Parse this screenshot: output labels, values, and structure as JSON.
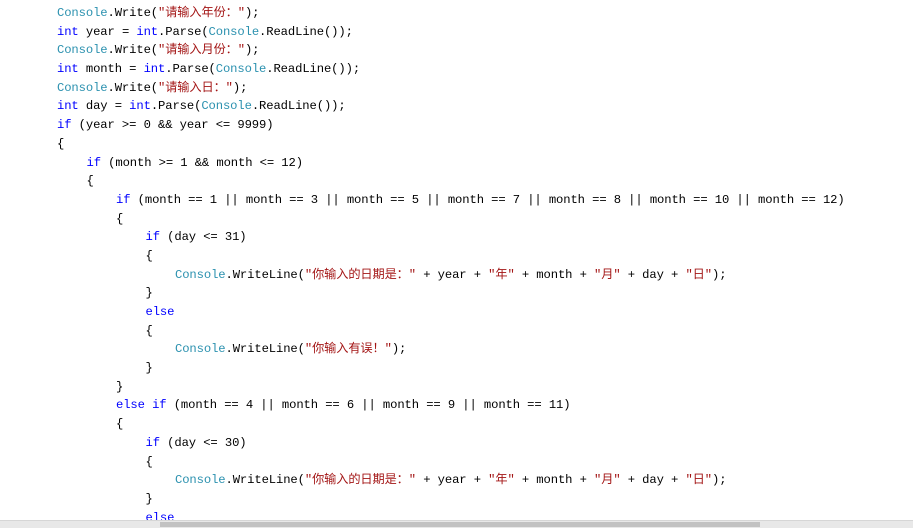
{
  "colors": {
    "keyword": "#0000ff",
    "type": "#2b91af",
    "string": "#a31515",
    "text": "#000000"
  },
  "code_lines": [
    {
      "indent": 0,
      "tokens": [
        [
          "ty",
          "Console"
        ],
        [
          "pl",
          ".Write("
        ],
        [
          "st",
          "\"请输入年份：\""
        ],
        [
          "pl",
          ");"
        ]
      ]
    },
    {
      "indent": 0,
      "tokens": [
        [
          "kw",
          "int"
        ],
        [
          "pl",
          " year = "
        ],
        [
          "kw",
          "int"
        ],
        [
          "pl",
          ".Parse("
        ],
        [
          "ty",
          "Console"
        ],
        [
          "pl",
          ".ReadLine());"
        ]
      ]
    },
    {
      "indent": 0,
      "tokens": [
        [
          "ty",
          "Console"
        ],
        [
          "pl",
          ".Write("
        ],
        [
          "st",
          "\"请输入月份：\""
        ],
        [
          "pl",
          ");"
        ]
      ]
    },
    {
      "indent": 0,
      "tokens": [
        [
          "kw",
          "int"
        ],
        [
          "pl",
          " month = "
        ],
        [
          "kw",
          "int"
        ],
        [
          "pl",
          ".Parse("
        ],
        [
          "ty",
          "Console"
        ],
        [
          "pl",
          ".ReadLine());"
        ]
      ]
    },
    {
      "indent": 0,
      "tokens": [
        [
          "ty",
          "Console"
        ],
        [
          "pl",
          ".Write("
        ],
        [
          "st",
          "\"请输入日：\""
        ],
        [
          "pl",
          ");"
        ]
      ]
    },
    {
      "indent": 0,
      "tokens": [
        [
          "kw",
          "int"
        ],
        [
          "pl",
          " day = "
        ],
        [
          "kw",
          "int"
        ],
        [
          "pl",
          ".Parse("
        ],
        [
          "ty",
          "Console"
        ],
        [
          "pl",
          ".ReadLine());"
        ]
      ]
    },
    {
      "indent": 0,
      "tokens": [
        [
          "kw",
          "if"
        ],
        [
          "pl",
          " (year >= 0 && year <= 9999)"
        ]
      ]
    },
    {
      "indent": 0,
      "tokens": [
        [
          "pl",
          "{"
        ]
      ]
    },
    {
      "indent": 1,
      "tokens": [
        [
          "kw",
          "if"
        ],
        [
          "pl",
          " (month >= 1 && month <= 12)"
        ]
      ]
    },
    {
      "indent": 1,
      "tokens": [
        [
          "pl",
          "{"
        ]
      ]
    },
    {
      "indent": 2,
      "tokens": [
        [
          "kw",
          "if"
        ],
        [
          "pl",
          " (month == 1 || month == 3 || month == 5 || month == 7 || month == 8 || month == 10 || month == 12)"
        ]
      ]
    },
    {
      "indent": 2,
      "tokens": [
        [
          "pl",
          "{"
        ]
      ]
    },
    {
      "indent": 3,
      "tokens": [
        [
          "kw",
          "if"
        ],
        [
          "pl",
          " (day <= 31)"
        ]
      ]
    },
    {
      "indent": 3,
      "tokens": [
        [
          "pl",
          "{"
        ]
      ]
    },
    {
      "indent": 4,
      "tokens": [
        [
          "ty",
          "Console"
        ],
        [
          "pl",
          ".WriteLine("
        ],
        [
          "st",
          "\"你输入的日期是：\""
        ],
        [
          "pl",
          " + year + "
        ],
        [
          "st",
          "\"年\""
        ],
        [
          "pl",
          " + month + "
        ],
        [
          "st",
          "\"月\""
        ],
        [
          "pl",
          " + day + "
        ],
        [
          "st",
          "\"日\""
        ],
        [
          "pl",
          ");"
        ]
      ]
    },
    {
      "indent": 3,
      "tokens": [
        [
          "pl",
          "}"
        ]
      ]
    },
    {
      "indent": 3,
      "tokens": [
        [
          "kw",
          "else"
        ]
      ]
    },
    {
      "indent": 3,
      "tokens": [
        [
          "pl",
          "{"
        ]
      ]
    },
    {
      "indent": 4,
      "tokens": [
        [
          "ty",
          "Console"
        ],
        [
          "pl",
          ".WriteLine("
        ],
        [
          "st",
          "\"你输入有误！\""
        ],
        [
          "pl",
          ");"
        ]
      ]
    },
    {
      "indent": 3,
      "tokens": [
        [
          "pl",
          "}"
        ]
      ]
    },
    {
      "indent": 2,
      "tokens": [
        [
          "pl",
          "}"
        ]
      ]
    },
    {
      "indent": 2,
      "tokens": [
        [
          "kw",
          "else if"
        ],
        [
          "pl",
          " (month == 4 || month == 6 || month == 9 || month == 11)"
        ]
      ]
    },
    {
      "indent": 2,
      "tokens": [
        [
          "pl",
          "{"
        ]
      ]
    },
    {
      "indent": 3,
      "tokens": [
        [
          "kw",
          "if"
        ],
        [
          "pl",
          " (day <= 30)"
        ]
      ]
    },
    {
      "indent": 3,
      "tokens": [
        [
          "pl",
          "{"
        ]
      ]
    },
    {
      "indent": 4,
      "tokens": [
        [
          "ty",
          "Console"
        ],
        [
          "pl",
          ".WriteLine("
        ],
        [
          "st",
          "\"你输入的日期是：\""
        ],
        [
          "pl",
          " + year + "
        ],
        [
          "st",
          "\"年\""
        ],
        [
          "pl",
          " + month + "
        ],
        [
          "st",
          "\"月\""
        ],
        [
          "pl",
          " + day + "
        ],
        [
          "st",
          "\"日\""
        ],
        [
          "pl",
          ");"
        ]
      ]
    },
    {
      "indent": 3,
      "tokens": [
        [
          "pl",
          "}"
        ]
      ]
    },
    {
      "indent": 3,
      "tokens": [
        [
          "kw",
          "else"
        ]
      ]
    }
  ]
}
